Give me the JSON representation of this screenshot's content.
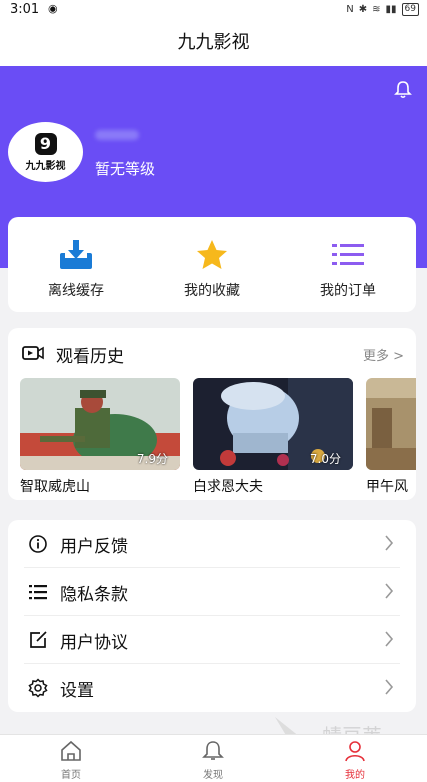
{
  "status_bar": {
    "time": "3:01",
    "battery": "69"
  },
  "header": {
    "title": "九九影视"
  },
  "profile": {
    "logo_text": "九九影视",
    "level": "暂无等级"
  },
  "quick_actions": [
    {
      "label": "离线缓存",
      "icon": "download-icon"
    },
    {
      "label": "我的收藏",
      "icon": "star-icon"
    },
    {
      "label": "我的订单",
      "icon": "list-icon"
    }
  ],
  "history": {
    "title": "观看历史",
    "more": "更多 >",
    "items": [
      {
        "title": "智取威虎山",
        "rating": "7.9分"
      },
      {
        "title": "白求恩大夫",
        "rating": "7.0分"
      },
      {
        "title": "甲午风",
        "rating": ""
      }
    ]
  },
  "menu": [
    {
      "label": "用户反馈",
      "icon": "info-icon"
    },
    {
      "label": "隐私条款",
      "icon": "list-bullets-icon"
    },
    {
      "label": "用户协议",
      "icon": "edit-icon"
    },
    {
      "label": "设置",
      "icon": "gear-icon"
    }
  ],
  "tabs": [
    {
      "label": "首页",
      "icon": "home-icon"
    },
    {
      "label": "发现",
      "icon": "bell-icon"
    },
    {
      "label": "我的",
      "icon": "user-icon"
    }
  ],
  "watermark": {
    "text": "蜻豆荚"
  },
  "colors": {
    "accent": "#6a4df5",
    "active_tab": "#e6303a",
    "download": "#1a7bd6",
    "star": "#f6b81c",
    "list": "#8c5cf0"
  }
}
